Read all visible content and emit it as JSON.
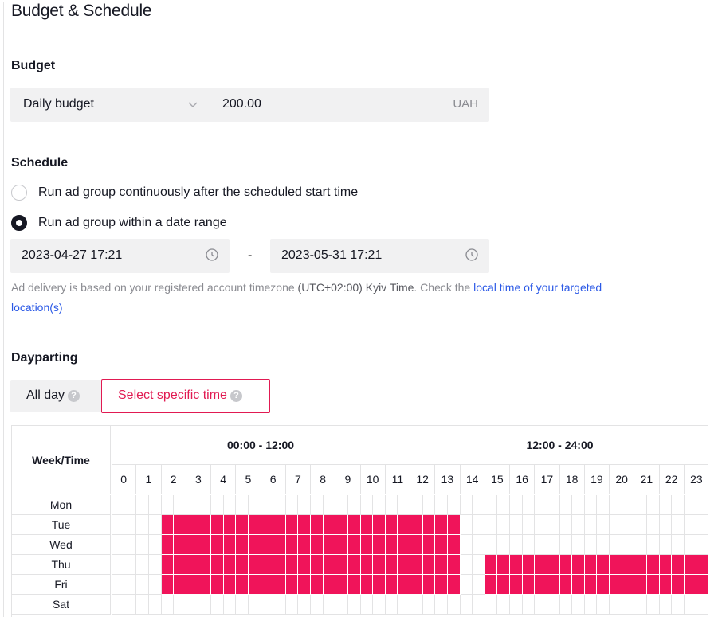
{
  "page": {
    "title": "Budget & Schedule"
  },
  "budget": {
    "section_label": "Budget",
    "type_value": "Daily budget",
    "amount_value": "200.00",
    "currency": "UAH"
  },
  "schedule": {
    "section_label": "Schedule",
    "options": [
      {
        "label": "Run ad group continuously after the scheduled start time",
        "checked": false
      },
      {
        "label": "Run ad group within a date range",
        "checked": true
      }
    ],
    "start_datetime": "2023-04-27 17:21",
    "separator": "-",
    "end_datetime": "2023-05-31 17:21",
    "timezone_note": {
      "prefix": "Ad delivery is based on your registered account timezone ",
      "timezone": "(UTC+02:00) Kyiv Time",
      "middle": ". Check the ",
      "link_text": "local time of your targeted location(s)"
    }
  },
  "dayparting": {
    "section_label": "Dayparting",
    "all_day_label": "All day",
    "specific_label": "Select specific time",
    "help_glyph": "?",
    "selected_mode": "specific",
    "corner_label": "Week/Time",
    "half_headers": [
      "00:00 - 12:00",
      "12:00 - 24:00"
    ],
    "hours": [
      "0",
      "1",
      "2",
      "3",
      "4",
      "5",
      "6",
      "7",
      "8",
      "9",
      "10",
      "11",
      "12",
      "13",
      "14",
      "15",
      "16",
      "17",
      "18",
      "19",
      "20",
      "21",
      "22",
      "23"
    ],
    "days": [
      {
        "label": "Mon",
        "slots": ""
      },
      {
        "label": "Tue",
        "slots": "4-27"
      },
      {
        "label": "Wed",
        "slots": "4-27"
      },
      {
        "label": "Thu",
        "slots": "4-27,30-47"
      },
      {
        "label": "Fri",
        "slots": "4-27,30-47"
      },
      {
        "label": "Sat",
        "slots": ""
      }
    ],
    "slot_note": "Half-hour slot indices 0-47 that are selected",
    "selected_color": "#f0145a"
  }
}
